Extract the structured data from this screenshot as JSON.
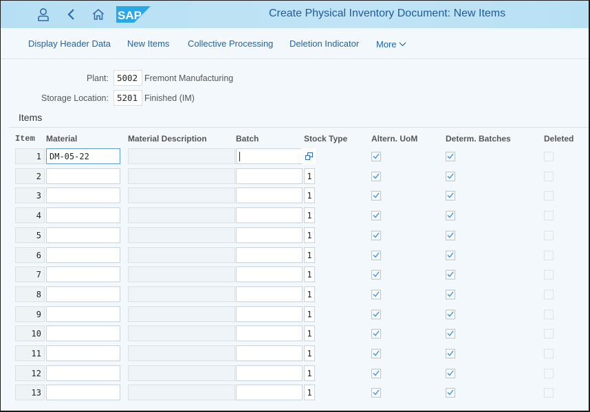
{
  "shell": {
    "title": "Create Physical Inventory Document: New Items",
    "icons": [
      "user-icon",
      "back-icon",
      "home-icon",
      "sap-logo"
    ],
    "brand_color": "#1c5b9c",
    "logo_color": "#2aa8e6"
  },
  "toolbar": {
    "items": [
      {
        "label": "Display Header Data"
      },
      {
        "label": "New Items"
      },
      {
        "label": "Collective Processing"
      },
      {
        "label": "Deletion Indicator"
      },
      {
        "label": "More",
        "icon": "chevron-down-icon"
      }
    ]
  },
  "header": {
    "plant": {
      "label": "Plant:",
      "value": "5002",
      "description": "Fremont Manufacturing"
    },
    "storage_location": {
      "label": "Storage Location:",
      "value": "5201",
      "description": "Finished (IM)"
    }
  },
  "items_section": {
    "title": "Items",
    "columns": {
      "item": "Item",
      "material": "Material",
      "material_description": "Material Description",
      "batch": "Batch",
      "stock_type": "Stock Type",
      "altern_uom": "Altern. UoM",
      "determ_batches": "Determ. Batches",
      "deleted": "Deleted"
    },
    "rows": [
      {
        "item": "1",
        "material": "DM-05-22",
        "description": "",
        "batch": "",
        "stock_type": "",
        "stock_type_icon": "value-help-icon",
        "altern_uom": true,
        "determ_batches": true,
        "deleted": false
      },
      {
        "item": "2",
        "material": "",
        "description": "",
        "batch": "",
        "stock_type": "1",
        "altern_uom": true,
        "determ_batches": true,
        "deleted": false
      },
      {
        "item": "3",
        "material": "",
        "description": "",
        "batch": "",
        "stock_type": "1",
        "altern_uom": true,
        "determ_batches": true,
        "deleted": false
      },
      {
        "item": "4",
        "material": "",
        "description": "",
        "batch": "",
        "stock_type": "1",
        "altern_uom": true,
        "determ_batches": true,
        "deleted": false
      },
      {
        "item": "5",
        "material": "",
        "description": "",
        "batch": "",
        "stock_type": "1",
        "altern_uom": true,
        "determ_batches": true,
        "deleted": false
      },
      {
        "item": "6",
        "material": "",
        "description": "",
        "batch": "",
        "stock_type": "1",
        "altern_uom": true,
        "determ_batches": true,
        "deleted": false
      },
      {
        "item": "7",
        "material": "",
        "description": "",
        "batch": "",
        "stock_type": "1",
        "altern_uom": true,
        "determ_batches": true,
        "deleted": false
      },
      {
        "item": "8",
        "material": "",
        "description": "",
        "batch": "",
        "stock_type": "1",
        "altern_uom": true,
        "determ_batches": true,
        "deleted": false
      },
      {
        "item": "9",
        "material": "",
        "description": "",
        "batch": "",
        "stock_type": "1",
        "altern_uom": true,
        "determ_batches": true,
        "deleted": false
      },
      {
        "item": "10",
        "material": "",
        "description": "",
        "batch": "",
        "stock_type": "1",
        "altern_uom": true,
        "determ_batches": true,
        "deleted": false
      },
      {
        "item": "11",
        "material": "",
        "description": "",
        "batch": "",
        "stock_type": "1",
        "altern_uom": true,
        "determ_batches": true,
        "deleted": false
      },
      {
        "item": "12",
        "material": "",
        "description": "",
        "batch": "",
        "stock_type": "1",
        "altern_uom": true,
        "determ_batches": true,
        "deleted": false
      },
      {
        "item": "13",
        "material": "",
        "description": "",
        "batch": "",
        "stock_type": "1",
        "altern_uom": true,
        "determ_batches": true,
        "deleted": false
      }
    ]
  }
}
